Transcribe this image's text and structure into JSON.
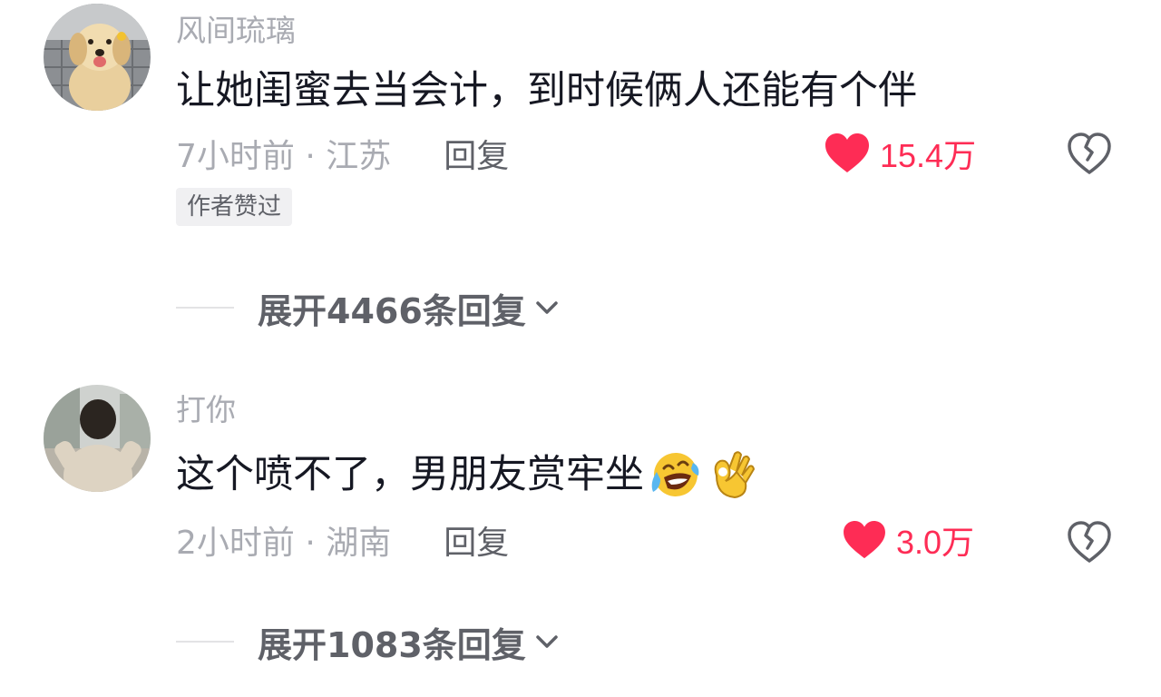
{
  "comments": [
    {
      "username": "风间琉璃",
      "text": "让她闺蜜去当会计，到时候俩人还能有个伴",
      "time_location": "7小时前 · 江苏",
      "reply_label": "回复",
      "likes": "15.4万",
      "badge": "作者赞过",
      "expand_label": "展开4466条回复",
      "emojis": []
    },
    {
      "username": "打你",
      "text": "这个喷不了，男朋友赏牢坐",
      "time_location": "2小时前 · 湖南",
      "reply_label": "回复",
      "likes": "3.0万",
      "badge": "",
      "expand_label": "展开1083条回复",
      "emojis": [
        "laughing-crying-emoji",
        "ok-hand-emoji"
      ]
    }
  ],
  "colors": {
    "like_red": "#fe2c55",
    "secondary_gray": "#a9abb2",
    "reply_gray": "#5f6168"
  }
}
